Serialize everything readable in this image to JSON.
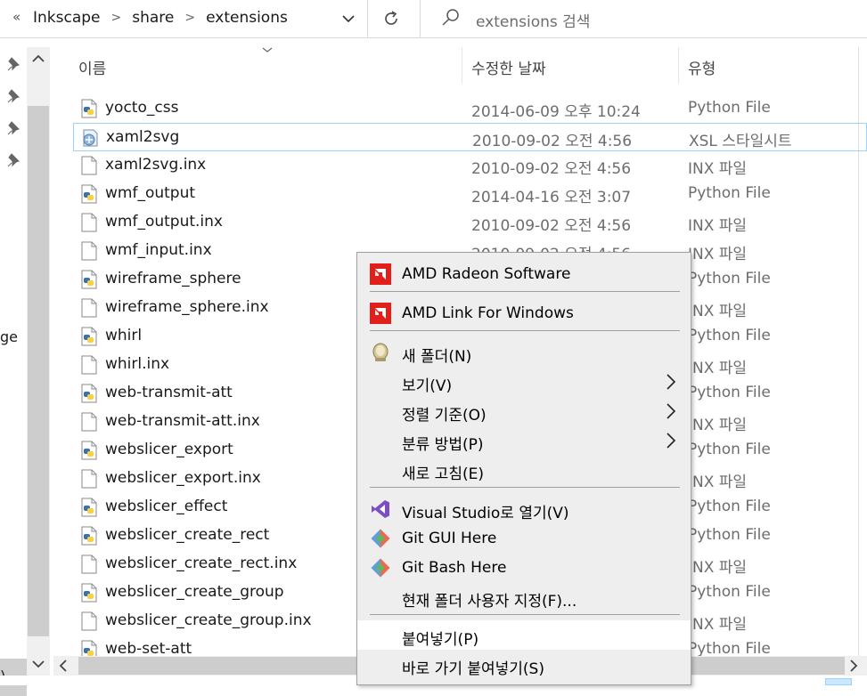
{
  "address": {
    "lead": "«",
    "crumbs": [
      "Inkscape",
      "share",
      "extensions"
    ],
    "search_placeholder": "extensions 검색"
  },
  "nav": {
    "frag1": "ge",
    "frag2": ")"
  },
  "columns": {
    "name": "이름",
    "date": "수정한 날짜",
    "type": "유형"
  },
  "files": [
    {
      "name": "yocto_css",
      "date": "2014-06-09 오후 10:24",
      "type": "Python File",
      "icon": "python-file-icon"
    },
    {
      "name": "xaml2svg",
      "date": "2010-09-02 오전 4:56",
      "type": "XSL 스타일시트",
      "icon": "xsl-file-icon"
    },
    {
      "name": "xaml2svg.inx",
      "date": "2010-09-02 오전 4:56",
      "type": "INX 파일",
      "icon": "blank-file-icon"
    },
    {
      "name": "wmf_output",
      "date": "2014-04-16 오전 3:07",
      "type": "Python File",
      "icon": "python-file-icon"
    },
    {
      "name": "wmf_output.inx",
      "date": "2010-09-02 오전 4:56",
      "type": "INX 파일",
      "icon": "blank-file-icon"
    },
    {
      "name": "wmf_input.inx",
      "date": "2010-09-02 오전 4:56",
      "type": "INX 파일",
      "icon": "blank-file-icon"
    },
    {
      "name": "wireframe_sphere",
      "date": "",
      "type": "Python File",
      "icon": "python-file-icon"
    },
    {
      "name": "wireframe_sphere.inx",
      "date": "",
      "type": "INX 파일",
      "icon": "blank-file-icon"
    },
    {
      "name": "whirl",
      "date": "",
      "type": "Python File",
      "icon": "python-file-icon"
    },
    {
      "name": "whirl.inx",
      "date": "",
      "type": "INX 파일",
      "icon": "blank-file-icon"
    },
    {
      "name": "web-transmit-att",
      "date": "",
      "type": "Python File",
      "icon": "python-file-icon"
    },
    {
      "name": "web-transmit-att.inx",
      "date": "",
      "type": "INX 파일",
      "icon": "blank-file-icon"
    },
    {
      "name": "webslicer_export",
      "date": "",
      "type": "Python File",
      "icon": "python-file-icon"
    },
    {
      "name": "webslicer_export.inx",
      "date": "",
      "type": "INX 파일",
      "icon": "blank-file-icon"
    },
    {
      "name": "webslicer_effect",
      "date": "",
      "type": "Python File",
      "icon": "python-file-icon"
    },
    {
      "name": "webslicer_create_rect",
      "date": "",
      "type": "Python File",
      "icon": "python-file-icon"
    },
    {
      "name": "webslicer_create_rect.inx",
      "date": "",
      "type": "INX 파일",
      "icon": "blank-file-icon"
    },
    {
      "name": "webslicer_create_group",
      "date": "",
      "type": "Python File",
      "icon": "python-file-icon"
    },
    {
      "name": "webslicer_create_group.inx",
      "date": "",
      "type": "INX 파일",
      "icon": "blank-file-icon"
    },
    {
      "name": "web-set-att",
      "date": "",
      "type": "Python File",
      "icon": "python-file-icon"
    }
  ],
  "context_menu": {
    "items": [
      {
        "label": "AMD Radeon Software",
        "icon": "amd-icon",
        "submenu": false
      },
      {
        "label": "AMD Link For Windows",
        "icon": "amd-icon",
        "submenu": false
      },
      {
        "label": "새 폴더(N)",
        "icon": "new-folder-icon",
        "submenu": false
      },
      {
        "label": "보기(V)",
        "icon": "",
        "submenu": true
      },
      {
        "label": "정렬 기준(O)",
        "icon": "",
        "submenu": true
      },
      {
        "label": "분류 방법(P)",
        "icon": "",
        "submenu": true
      },
      {
        "label": "새로 고침(E)",
        "icon": "",
        "submenu": false
      },
      {
        "label": "Visual Studio로 열기(V)",
        "icon": "visual-studio-icon",
        "submenu": false
      },
      {
        "label": "Git GUI Here",
        "icon": "git-icon",
        "submenu": false
      },
      {
        "label": "Git Bash Here",
        "icon": "git-icon",
        "submenu": false
      },
      {
        "label": "현재 폴더 사용자 지정(F)...",
        "icon": "",
        "submenu": false
      },
      {
        "label": "붙여넣기(P)",
        "icon": "",
        "submenu": false
      },
      {
        "label": "바로 가기 붙여넣기(S)",
        "icon": "",
        "submenu": false
      }
    ]
  },
  "colors": {
    "amd_red": "#e2201b",
    "git_orange": "#f05033",
    "vs_purple": "#7b4fbf",
    "python_blue": "#3a6fb0",
    "python_yellow": "#f7d240"
  }
}
